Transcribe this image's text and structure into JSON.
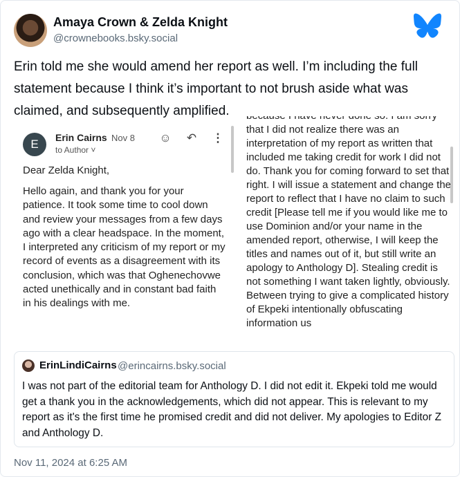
{
  "author": {
    "name": "Amaya Crown & Zelda Knight",
    "handle": "@crownebooks.bsky.social"
  },
  "post": {
    "text": "Erin told me she would amend her report as well. I’m including the full statement because I think it’s important to not brush aside what was claimed, and subsequently amplified.",
    "timestamp": "Nov 11, 2024 at 6:25 AM"
  },
  "image_left": {
    "avatar_letter": "E",
    "from": "Erin Cairns",
    "date": "Nov 8",
    "to": "to Author ˅",
    "greeting": "Dear Zelda Knight,",
    "body": "Hello again, and thank you for your patience. It took some time to cool down and review your messages from a few days ago with a clear headspace. In the moment, I interpreted any criticism of my report or my record of events as a disagreement with its conclusion, which was that Oghenechovwe acted unethically and in constant bad faith in his dealings with me."
  },
  "image_right": {
    "body": "because I have never done so. I am sorry that I did not realize there was an interpretation of my report as written that included me taking credit for work I did not do. Thank you for coming forward to set that right. I will issue a statement and change the report to reflect that I have no claim to such credit [Please tell me if you would like me to use Dominion and/or your name in the amended report, otherwise, I will keep the titles and names out of it, but still write an apology to Anthology D]. Stealing credit is not something I want taken lightly, obviously. Between trying to give a complicated history of Ekpeki intentionally obfuscating information us"
  },
  "quote": {
    "name": "ErinLindiCairns",
    "handle": "@erincairns.bsky.social",
    "text": "I was not part of the editorial team for Anthology D. I did not edit it. Ekpeki told me would get a thank you in the acknowledgements, which did not appear. This is relevant to my report as it's the first time he promised credit and did not deliver. My apologies to Editor Z and Anthology D."
  },
  "icons": {
    "logo": "bluesky-butterfly-icon",
    "emoji": "smiley-icon",
    "reply": "reply-arrow-icon",
    "more": "more-vertical-icon"
  },
  "colors": {
    "brand": "#1185fe",
    "muted": "#5a6977"
  }
}
